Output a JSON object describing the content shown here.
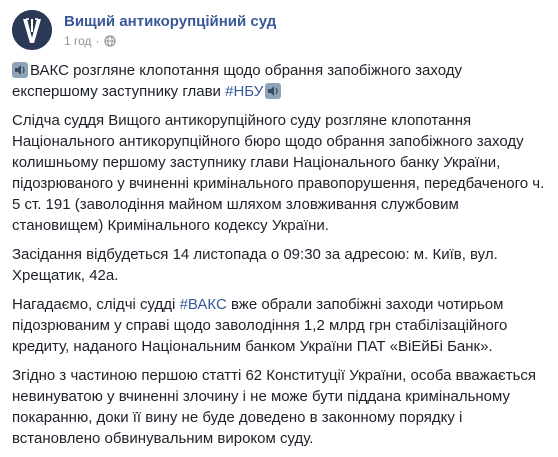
{
  "header": {
    "page_name": "Вищий антикорупційний суд",
    "timestamp": "1 год",
    "separator": "·",
    "privacy_icon": "globe-icon",
    "avatar_icon": "court-logo-icon",
    "colors": {
      "name": "#385898",
      "meta": "#90949c",
      "avatar_bg": "#2a3a56"
    }
  },
  "post": {
    "headline": {
      "lead_icon": "speaker-emoji-icon",
      "text": "ВАКС розгляне клопотання щодо обрання запобіжного заходу експершому заступнику глави ",
      "hashtag": "#НБУ",
      "trail_icon": "speaker-emoji-icon"
    },
    "paragraphs": [
      {
        "text": "Слідча суддя Вищого антикорупційного суду розгляне клопотання Національного антикорупційного бюро щодо обрання запобіжного заходу колишньому першому заступнику глави Національного банку України, підозрюваного у вчиненні кримінального правопорушення, передбаченого ч. 5 ст. 191 (заволодіння майном шляхом зловживання службовим становищем) Кримінального кодексу України."
      },
      {
        "text": "Засідання відбудеться 14 листопада о 09:30 за адресою: м. Київ, вул. Хрещатик, 42а."
      },
      {
        "before": "Нагадаємо, слідчі судді ",
        "hashtag": "#ВАКС",
        "after": " вже обрали запобіжні заходи чотирьом підозрюваним у справі щодо заволодіння 1,2 млрд грн стабілізаційного кредиту, наданого Національним банком України ПАТ «ВіЕйБі Банк»."
      },
      {
        "text": "Згідно з частиною першою статті 62 Конституції України, особа вважається невинуватою у вчиненні злочину і не може бути піддана кримінальному покаранню, доки її вину не буде доведено в законному порядку і встановлено обвинувальним вироком суду."
      }
    ],
    "colors": {
      "text": "#1d2129",
      "hashtag": "#365899"
    }
  }
}
